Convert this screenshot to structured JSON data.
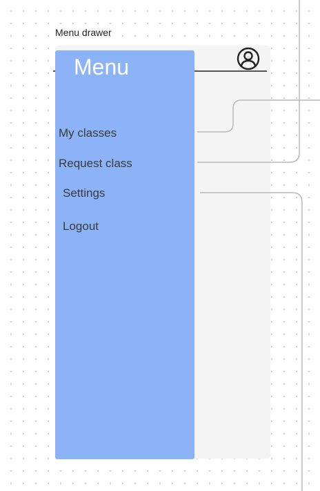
{
  "frame": {
    "title": "Menu drawer"
  },
  "header": {
    "icon": "user-avatar-icon"
  },
  "drawer": {
    "title": "Menu",
    "color": "#8cb3f7",
    "items": [
      {
        "label": "My classes"
      },
      {
        "label": "Request class"
      },
      {
        "label": "Settings"
      },
      {
        "label": "Logout"
      }
    ]
  }
}
